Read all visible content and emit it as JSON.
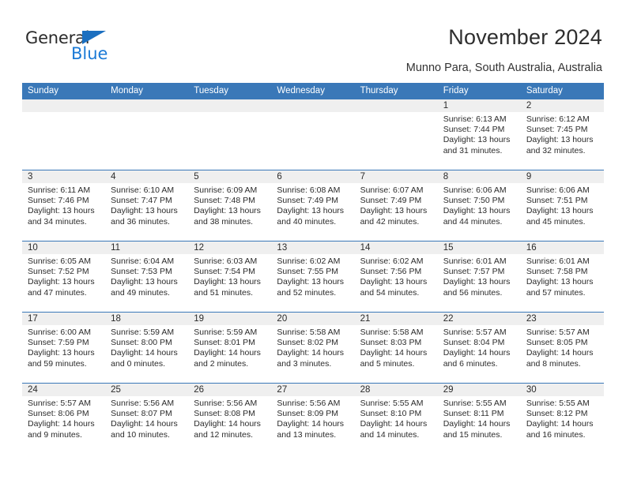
{
  "brand": {
    "name_top": "General",
    "name_bottom": "Blue",
    "triangle_color": "#1b6fc0",
    "blue_text_color": "#1b7ad6"
  },
  "header": {
    "title": "November 2024",
    "location": "Munno Para, South Australia, Australia",
    "accent_color": "#3a78b8"
  },
  "weekdays": [
    "Sunday",
    "Monday",
    "Tuesday",
    "Wednesday",
    "Thursday",
    "Friday",
    "Saturday"
  ],
  "weeks": [
    [
      {
        "day": "",
        "empty": true
      },
      {
        "day": "",
        "empty": true
      },
      {
        "day": "",
        "empty": true
      },
      {
        "day": "",
        "empty": true
      },
      {
        "day": "",
        "empty": true
      },
      {
        "day": "1",
        "sunrise": "Sunrise: 6:13 AM",
        "sunset": "Sunset: 7:44 PM",
        "daylight": "Daylight: 13 hours and 31 minutes."
      },
      {
        "day": "2",
        "sunrise": "Sunrise: 6:12 AM",
        "sunset": "Sunset: 7:45 PM",
        "daylight": "Daylight: 13 hours and 32 minutes."
      }
    ],
    [
      {
        "day": "3",
        "sunrise": "Sunrise: 6:11 AM",
        "sunset": "Sunset: 7:46 PM",
        "daylight": "Daylight: 13 hours and 34 minutes."
      },
      {
        "day": "4",
        "sunrise": "Sunrise: 6:10 AM",
        "sunset": "Sunset: 7:47 PM",
        "daylight": "Daylight: 13 hours and 36 minutes."
      },
      {
        "day": "5",
        "sunrise": "Sunrise: 6:09 AM",
        "sunset": "Sunset: 7:48 PM",
        "daylight": "Daylight: 13 hours and 38 minutes."
      },
      {
        "day": "6",
        "sunrise": "Sunrise: 6:08 AM",
        "sunset": "Sunset: 7:49 PM",
        "daylight": "Daylight: 13 hours and 40 minutes."
      },
      {
        "day": "7",
        "sunrise": "Sunrise: 6:07 AM",
        "sunset": "Sunset: 7:49 PM",
        "daylight": "Daylight: 13 hours and 42 minutes."
      },
      {
        "day": "8",
        "sunrise": "Sunrise: 6:06 AM",
        "sunset": "Sunset: 7:50 PM",
        "daylight": "Daylight: 13 hours and 44 minutes."
      },
      {
        "day": "9",
        "sunrise": "Sunrise: 6:06 AM",
        "sunset": "Sunset: 7:51 PM",
        "daylight": "Daylight: 13 hours and 45 minutes."
      }
    ],
    [
      {
        "day": "10",
        "sunrise": "Sunrise: 6:05 AM",
        "sunset": "Sunset: 7:52 PM",
        "daylight": "Daylight: 13 hours and 47 minutes."
      },
      {
        "day": "11",
        "sunrise": "Sunrise: 6:04 AM",
        "sunset": "Sunset: 7:53 PM",
        "daylight": "Daylight: 13 hours and 49 minutes."
      },
      {
        "day": "12",
        "sunrise": "Sunrise: 6:03 AM",
        "sunset": "Sunset: 7:54 PM",
        "daylight": "Daylight: 13 hours and 51 minutes."
      },
      {
        "day": "13",
        "sunrise": "Sunrise: 6:02 AM",
        "sunset": "Sunset: 7:55 PM",
        "daylight": "Daylight: 13 hours and 52 minutes."
      },
      {
        "day": "14",
        "sunrise": "Sunrise: 6:02 AM",
        "sunset": "Sunset: 7:56 PM",
        "daylight": "Daylight: 13 hours and 54 minutes."
      },
      {
        "day": "15",
        "sunrise": "Sunrise: 6:01 AM",
        "sunset": "Sunset: 7:57 PM",
        "daylight": "Daylight: 13 hours and 56 minutes."
      },
      {
        "day": "16",
        "sunrise": "Sunrise: 6:01 AM",
        "sunset": "Sunset: 7:58 PM",
        "daylight": "Daylight: 13 hours and 57 minutes."
      }
    ],
    [
      {
        "day": "17",
        "sunrise": "Sunrise: 6:00 AM",
        "sunset": "Sunset: 7:59 PM",
        "daylight": "Daylight: 13 hours and 59 minutes."
      },
      {
        "day": "18",
        "sunrise": "Sunrise: 5:59 AM",
        "sunset": "Sunset: 8:00 PM",
        "daylight": "Daylight: 14 hours and 0 minutes."
      },
      {
        "day": "19",
        "sunrise": "Sunrise: 5:59 AM",
        "sunset": "Sunset: 8:01 PM",
        "daylight": "Daylight: 14 hours and 2 minutes."
      },
      {
        "day": "20",
        "sunrise": "Sunrise: 5:58 AM",
        "sunset": "Sunset: 8:02 PM",
        "daylight": "Daylight: 14 hours and 3 minutes."
      },
      {
        "day": "21",
        "sunrise": "Sunrise: 5:58 AM",
        "sunset": "Sunset: 8:03 PM",
        "daylight": "Daylight: 14 hours and 5 minutes."
      },
      {
        "day": "22",
        "sunrise": "Sunrise: 5:57 AM",
        "sunset": "Sunset: 8:04 PM",
        "daylight": "Daylight: 14 hours and 6 minutes."
      },
      {
        "day": "23",
        "sunrise": "Sunrise: 5:57 AM",
        "sunset": "Sunset: 8:05 PM",
        "daylight": "Daylight: 14 hours and 8 minutes."
      }
    ],
    [
      {
        "day": "24",
        "sunrise": "Sunrise: 5:57 AM",
        "sunset": "Sunset: 8:06 PM",
        "daylight": "Daylight: 14 hours and 9 minutes."
      },
      {
        "day": "25",
        "sunrise": "Sunrise: 5:56 AM",
        "sunset": "Sunset: 8:07 PM",
        "daylight": "Daylight: 14 hours and 10 minutes."
      },
      {
        "day": "26",
        "sunrise": "Sunrise: 5:56 AM",
        "sunset": "Sunset: 8:08 PM",
        "daylight": "Daylight: 14 hours and 12 minutes."
      },
      {
        "day": "27",
        "sunrise": "Sunrise: 5:56 AM",
        "sunset": "Sunset: 8:09 PM",
        "daylight": "Daylight: 14 hours and 13 minutes."
      },
      {
        "day": "28",
        "sunrise": "Sunrise: 5:55 AM",
        "sunset": "Sunset: 8:10 PM",
        "daylight": "Daylight: 14 hours and 14 minutes."
      },
      {
        "day": "29",
        "sunrise": "Sunrise: 5:55 AM",
        "sunset": "Sunset: 8:11 PM",
        "daylight": "Daylight: 14 hours and 15 minutes."
      },
      {
        "day": "30",
        "sunrise": "Sunrise: 5:55 AM",
        "sunset": "Sunset: 8:12 PM",
        "daylight": "Daylight: 14 hours and 16 minutes."
      }
    ]
  ]
}
